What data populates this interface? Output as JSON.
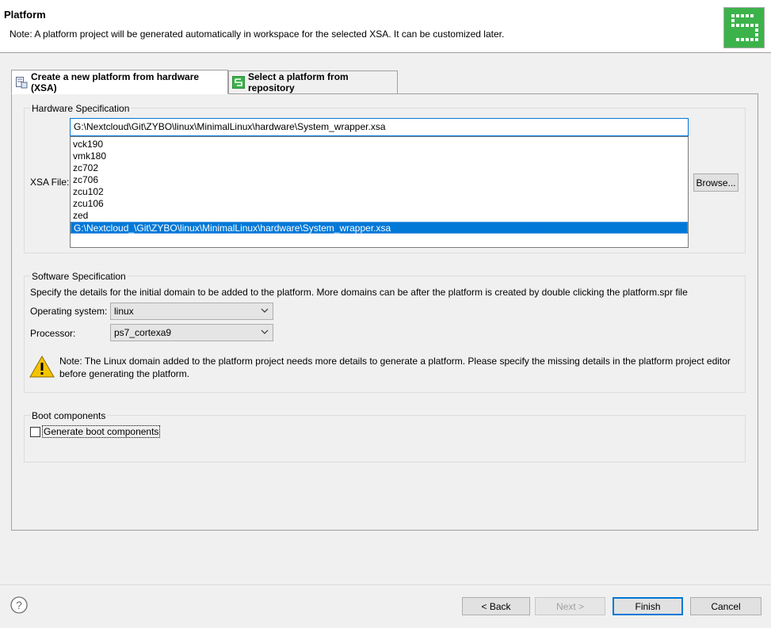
{
  "header": {
    "title": "Platform",
    "description": "Note: A platform project will be generated automatically in workspace for the selected XSA. It can be customized later.",
    "icon": "platform-wizard-icon"
  },
  "tabs": [
    {
      "label": "Create a new platform from hardware (XSA)",
      "icon": "hardware-icon",
      "active": true
    },
    {
      "label": "Select a platform from repository",
      "icon": "repository-icon",
      "active": false
    }
  ],
  "hardware": {
    "group_label": "Hardware Specification",
    "xsa_label": "XSA File:",
    "xsa_value": "G:\\Nextcloud\\Git\\ZYBO\\linux\\MinimalLinux\\hardware\\System_wrapper.xsa",
    "dropdown_items": [
      "vck190",
      "vmk180",
      "zc702",
      "zc706",
      "zcu102",
      "zcu106",
      "zed",
      "G:\\Nextcloud_\\Git\\ZYBO\\linux\\MinimalLinux\\hardware\\System_wrapper.xsa"
    ],
    "selected_index": 7,
    "browse_label": "Browse..."
  },
  "software": {
    "group_label": "Software Specification",
    "description": "Specify the details for the initial domain to be added to the platform. More domains can be after the platform is created by double clicking the platform.spr file",
    "os_label": "Operating system:",
    "os_value": "linux",
    "processor_label": "Processor:",
    "processor_value": "ps7_cortexa9",
    "note_line1": "Note: The Linux domain added to the platform project needs more details to generate a platform. Please specify the missing details in the platform project editor",
    "note_line2": "before generating the platform.",
    "note_icon": "warning-icon"
  },
  "boot": {
    "group_label": "Boot components",
    "checkbox_label": "Generate boot components",
    "checked": false
  },
  "footer": {
    "help_icon": "help-icon",
    "back_label": "< Back",
    "next_label": "Next >",
    "finish_label": "Finish",
    "cancel_label": "Cancel"
  },
  "colors": {
    "selection": "#0078d7",
    "brand_green": "#3bb34a",
    "warning_yellow": "#f5c400"
  }
}
